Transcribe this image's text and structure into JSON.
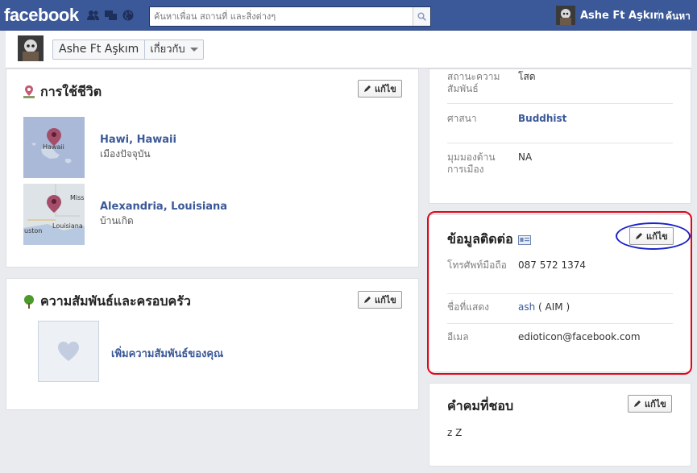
{
  "topbar": {
    "logo": "facebook",
    "search_placeholder": "ค้นหาเพื่อน สถานที่ และสิ่งต่างๆ",
    "user_name": "Ashe Ft Aşkım",
    "find_friends": "ค้นหา"
  },
  "profile": {
    "name": "Ashe Ft Aşkım",
    "section": "เกี่ยวกับ"
  },
  "edit_label": "แก้ไข",
  "living": {
    "title": "การใช้ชีวิต",
    "places": [
      {
        "name": "Hawi, Hawaii",
        "sub": "เมืองปัจจุบัน",
        "map_label": "Hawaii"
      },
      {
        "name": "Alexandria, Louisiana",
        "sub": "บ้านเกิด",
        "map_labels": [
          "Miss",
          "Louisiana",
          "uston"
        ]
      }
    ]
  },
  "relationship": {
    "title": "ความสัมพันธ์และครอบครัว",
    "add_link": "เพิ่มความสัมพันธ์ของคุณ"
  },
  "basic_info": {
    "rows": [
      {
        "label": "สถานะความสัมพันธ์",
        "value": "โสด"
      },
      {
        "label": "ศาสนา",
        "value": "Buddhist"
      },
      {
        "label": "มุมมองด้านการเมือง",
        "value": "NA"
      }
    ]
  },
  "contact": {
    "title": "ข้อมูลติดต่อ",
    "rows": [
      {
        "label": "โทรศัพท์มือถือ",
        "value": "087 572 1374"
      },
      {
        "label": "ชื่อที่แสดง",
        "value": "ash",
        "suffix": " ( AIM )"
      },
      {
        "label": "อีเมล",
        "value": "edioticon@facebook.com"
      }
    ]
  },
  "quotes": {
    "title": "คำคมที่ชอบ",
    "text": "z Z"
  },
  "colors": {
    "brand": "#3b5998",
    "highlight_red": "#e3061a",
    "highlight_blue": "#1a22c8"
  }
}
